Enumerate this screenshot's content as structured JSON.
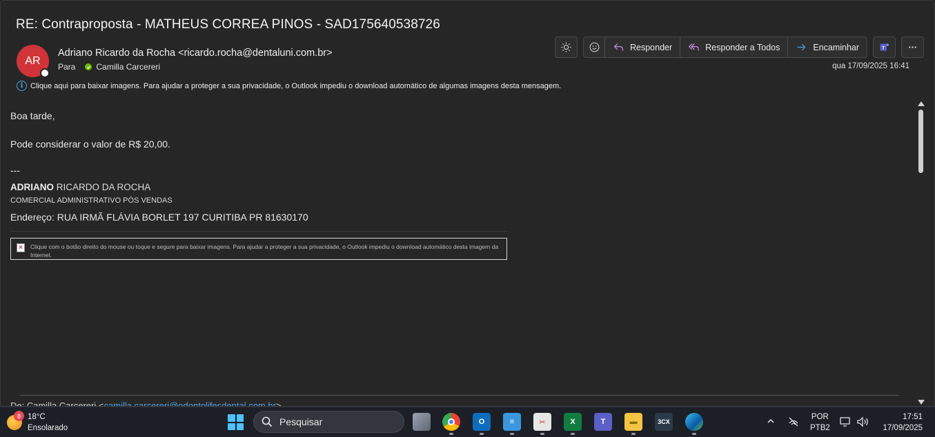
{
  "email": {
    "subject": "RE: Contraproposta - MATHEUS CORREA PINOS - SAD175640538726",
    "avatar_initials": "AR",
    "sender": "Adriano Ricardo da Rocha <ricardo.rocha@dentaluni.com.br>",
    "to_label": "Para",
    "recipient": "Camilla Carcereri",
    "datetime": "qua 17/09/2025 16:41",
    "images_notice": "Clique aqui para baixar imagens. Para ajudar a proteger a sua privacidade, o Outlook impediu o download automático de algumas imagens desta mensagem.",
    "greeting": "Boa tarde,",
    "body_line": "Pode considerar o valor de R$ 20,00.",
    "separator": "---",
    "signature": {
      "name_bold": "ADRIANO",
      "name_rest": " RICARDO DA ROCHA",
      "role": "COMERCIAL ADMINISTRATIVO PÓS VENDAS",
      "address": "Endereço: RUA IRMÃ FLÁVIA BORLET 197 CURITIBA PR 81630170"
    },
    "blocked_image_text": "Clique com o botão direito do mouse ou toque e segure para baixar imagens. Para ajudar a proteger a sua privacidade, o Outlook impediu o download automático desta imagem da Internet.",
    "cut_text_prefix": "De: Camilla Carcereri <",
    "cut_text_link": "camilla.carcereri@odontolifesdental.com.br",
    "cut_text_suffix": ">"
  },
  "toolbar": {
    "reply": "Responder",
    "reply_all": "Responder a Todos",
    "forward": "Encaminhar"
  },
  "taskbar": {
    "weather_badge": "8",
    "temperature": "18°C",
    "condition": "Ensolarado",
    "search_placeholder": "Pesquisar",
    "lang_top": "POR",
    "lang_bottom": "PTB2",
    "time": "17:51",
    "date": "17/09/2025",
    "app_3cx": "3CX"
  },
  "colors": {
    "avatar_bg": "#d13438",
    "accent_blue": "#4ea2e6",
    "presence_green": "#6bb700"
  }
}
